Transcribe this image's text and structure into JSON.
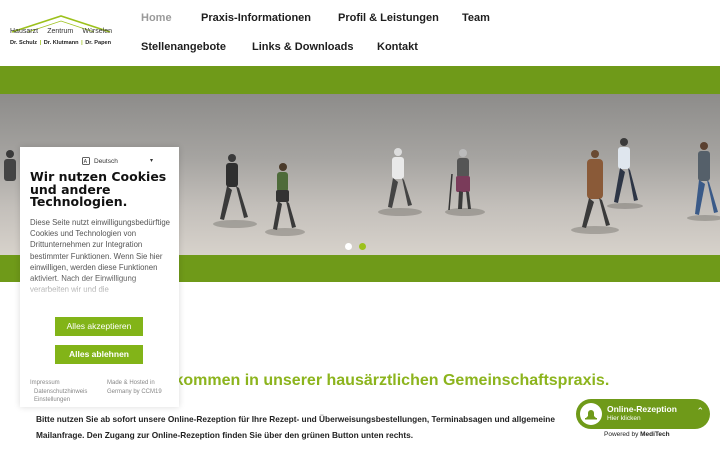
{
  "logo": {
    "left": "Hausarzt",
    "center": "Zentrum",
    "right": "Würselen",
    "doctors": [
      "Dr. Schulz",
      "Dr. Klutmann",
      "Dr. Papen"
    ],
    "accent": "#9cc11c"
  },
  "nav": {
    "items": [
      {
        "label": "Home",
        "active": true
      },
      {
        "label": "Praxis-Informationen"
      },
      {
        "label": "Profil & Leistungen"
      },
      {
        "label": "Team"
      },
      {
        "label": "Stellenangebote"
      },
      {
        "label": "Links & Downloads"
      },
      {
        "label": "Kontakt"
      }
    ]
  },
  "slider": {
    "dots": 2,
    "active_dot": 1
  },
  "cookie": {
    "language": "Deutsch",
    "title": "Wir nutzen Cookies und andere Technologien.",
    "body": "Diese Seite nutzt einwilligungsbedürftige Cookies und Technologien von Drittunternehmen zur Integration bestimmter Funktionen. Wenn Sie hier einwilligen, werden diese Funktionen aktiviert. Nach der Einwilligung verarbeiten wir und die",
    "accept_label": "Alles akzeptieren",
    "reject_label": "Alles ablehnen",
    "links": [
      "Impressum",
      "Datenschutzhinweis",
      "Einstellungen"
    ],
    "powered": "Made & Hosted in Germany by CCM19"
  },
  "main": {
    "welcome": "lkommen in unserer hausärztlichen Gemeinschaftspraxis.",
    "text": "Bitte nutzen Sie ab sofort unsere Online-Rezeption für Ihre Rezept- und Überweisungsbestellungen, Terminabsagen und allgemeine Mailanfrage. Den Zugang zur Online-Rezeption finden Sie über den grünen Button unten rechts."
  },
  "rezeption": {
    "title": "Online-Rezeption",
    "subtitle": "Hier klicken",
    "powered_prefix": "Powered by",
    "powered_brand": "MediTech"
  },
  "colors": {
    "green_band": "#6f9a19",
    "button": "#82b418",
    "welcome": "#8cb41d"
  }
}
